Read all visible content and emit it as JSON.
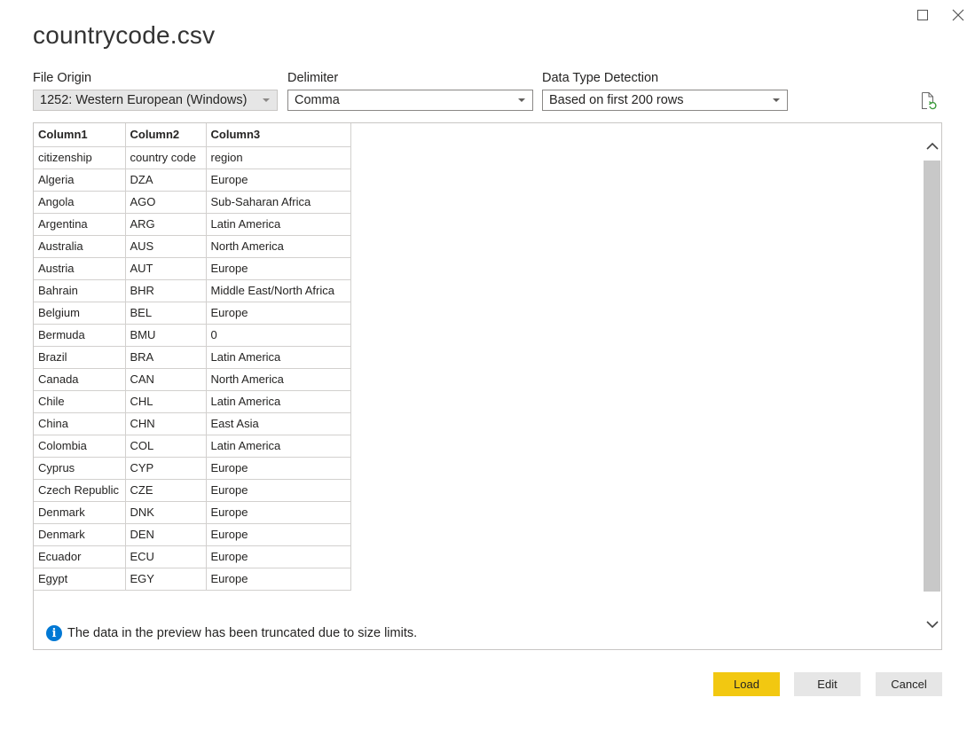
{
  "title": "countrycode.csv",
  "fields": {
    "file_origin": {
      "label": "File Origin",
      "value": "1252: Western European (Windows)"
    },
    "delimiter": {
      "label": "Delimiter",
      "value": "Comma"
    },
    "data_type_detection": {
      "label": "Data Type Detection",
      "value": "Based on first 200 rows"
    }
  },
  "table": {
    "headers": [
      "Column1",
      "Column2",
      "Column3"
    ],
    "rows": [
      [
        "citizenship",
        "country code",
        "region"
      ],
      [
        "Algeria",
        "DZA",
        "Europe"
      ],
      [
        "Angola",
        "AGO",
        "Sub-Saharan Africa"
      ],
      [
        "Argentina",
        "ARG",
        "Latin America"
      ],
      [
        "Australia",
        "AUS",
        "North America"
      ],
      [
        "Austria",
        "AUT",
        "Europe"
      ],
      [
        "Bahrain",
        "BHR",
        "Middle East/North Africa"
      ],
      [
        "Belgium",
        "BEL",
        "Europe"
      ],
      [
        "Bermuda",
        "BMU",
        "0"
      ],
      [
        "Brazil",
        "BRA",
        "Latin America"
      ],
      [
        "Canada",
        "CAN",
        "North America"
      ],
      [
        "Chile",
        "CHL",
        "Latin America"
      ],
      [
        "China",
        "CHN",
        "East Asia"
      ],
      [
        "Colombia",
        "COL",
        "Latin America"
      ],
      [
        "Cyprus",
        "CYP",
        "Europe"
      ],
      [
        "Czech Republic",
        "CZE",
        "Europe"
      ],
      [
        "Denmark",
        "DNK",
        "Europe"
      ],
      [
        "Denmark",
        "DEN",
        "Europe"
      ],
      [
        "Ecuador",
        "ECU",
        "Europe"
      ],
      [
        "Egypt",
        "EGY",
        "Europe"
      ]
    ]
  },
  "notice": "The data in the preview has been truncated due to size limits.",
  "buttons": {
    "load": "Load",
    "edit": "Edit",
    "cancel": "Cancel"
  },
  "icons": {
    "maximize": "maximize-icon",
    "close": "close-icon",
    "refresh": "refresh-file-icon",
    "info": "info-icon",
    "scroll_up": "chevron-up-icon",
    "scroll_down": "chevron-down-icon"
  },
  "colors": {
    "accent": "#f2c811",
    "info": "#0078d4"
  }
}
